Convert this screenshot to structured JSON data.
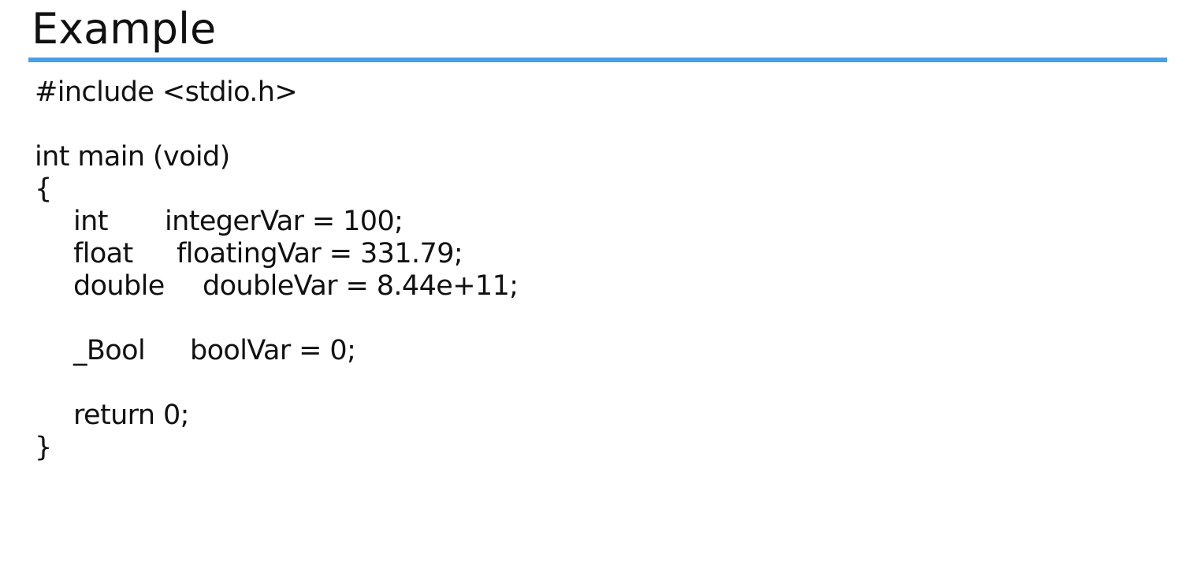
{
  "slide": {
    "title": "Example",
    "accent_color": "#4a9fe8"
  },
  "code": {
    "include": "#include <stdio.h>",
    "main_signature": "int main (void)",
    "open_brace": "{",
    "decl_int": {
      "type": "int",
      "statement": "integerVar = 100;"
    },
    "decl_float": {
      "type": "float",
      "statement": "floatingVar = 331.79;"
    },
    "decl_double": {
      "type": "double",
      "statement": "doubleVar = 8.44e+11;"
    },
    "decl_bool": {
      "type": "_Bool",
      "statement": "boolVar = 0;"
    },
    "return_stmt": "return 0;",
    "close_brace": "}"
  }
}
